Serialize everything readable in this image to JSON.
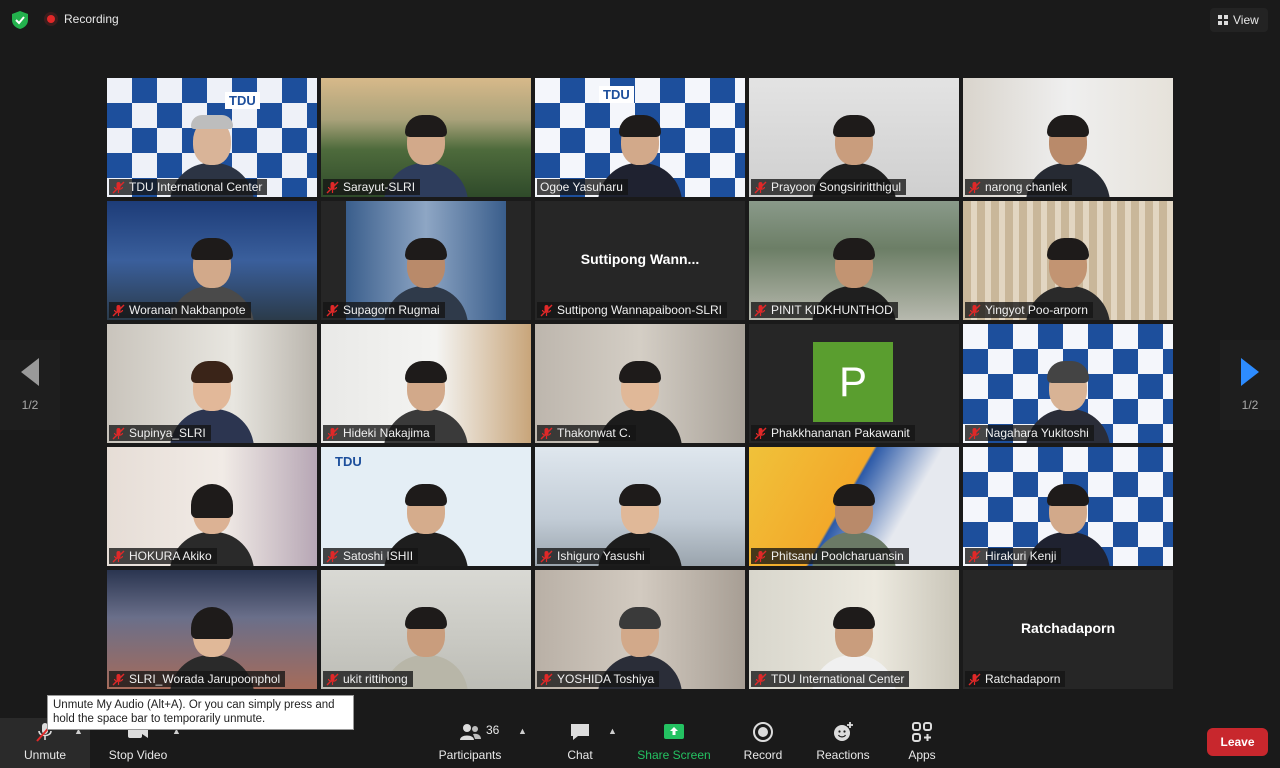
{
  "topbar": {
    "recording_label": "Recording",
    "view_label": "View",
    "shield_icon": "shield-check-icon",
    "recording_icon": "record-dot-icon",
    "grid_icon": "grid-view-icon"
  },
  "pagination": {
    "left": "1/2",
    "right": "1/2"
  },
  "participants": [
    {
      "name": "TDU International Center",
      "muted": true
    },
    {
      "name": "Sarayut-SLRI",
      "muted": true
    },
    {
      "name": "Ogoe Yasuharu",
      "muted": false,
      "active_speaker": true
    },
    {
      "name": "Prayoon Songsiriritthigul",
      "muted": true
    },
    {
      "name": "narong chanlek",
      "muted": true
    },
    {
      "name": "Woranan Nakbanpote",
      "muted": true
    },
    {
      "name": "Supagorn Rugmai",
      "muted": true
    },
    {
      "name": "Suttipong Wannapaiboon-SLRI",
      "muted": true,
      "video_off_label": "Suttipong  Wann..."
    },
    {
      "name": "PINIT KIDKHUNTHOD",
      "muted": true
    },
    {
      "name": "Yingyot Poo-arporn",
      "muted": true
    },
    {
      "name": "Supinya_SLRI",
      "muted": true
    },
    {
      "name": "Hideki Nakajima",
      "muted": true
    },
    {
      "name": "Thakonwat C.",
      "muted": true
    },
    {
      "name": "Phakkhananan Pakawanit",
      "muted": true,
      "avatar_letter": "P"
    },
    {
      "name": "Nagahara Yukitoshi",
      "muted": true
    },
    {
      "name": "HOKURA Akiko",
      "muted": true
    },
    {
      "name": "Satoshi ISHII",
      "muted": true
    },
    {
      "name": "Ishiguro Yasushi",
      "muted": true
    },
    {
      "name": "Phitsanu Poolcharuansin",
      "muted": true
    },
    {
      "name": "Hirakuri Kenji",
      "muted": true
    },
    {
      "name": "SLRI_Worada Jarupoonphol",
      "muted": true
    },
    {
      "name": "ukit rittihong",
      "muted": true
    },
    {
      "name": "YOSHIDA Toshiya",
      "muted": true
    },
    {
      "name": "TDU International Center",
      "muted": true
    },
    {
      "name": "Ratchadaporn",
      "muted": true,
      "video_off_label": "Ratchadaporn"
    }
  ],
  "tile_logos": {
    "tdu": "TDU"
  },
  "tooltip": {
    "text": "Unmute My Audio (Alt+A). Or you can simply press and hold the space bar to temporarily unmute."
  },
  "toolbar": {
    "unmute": "Unmute",
    "stop_video": "Stop Video",
    "participants": "Participants",
    "participants_count": "36",
    "chat": "Chat",
    "share_screen": "Share Screen",
    "record": "Record",
    "reactions": "Reactions",
    "apps": "Apps",
    "leave": "Leave"
  },
  "colors": {
    "background": "#1a1a1a",
    "active_speaker": "#e2e86a",
    "share_green": "#24c262",
    "leave_red": "#c8272d",
    "arrow_blue": "#2d8cff",
    "muted_red": "#e02828"
  }
}
